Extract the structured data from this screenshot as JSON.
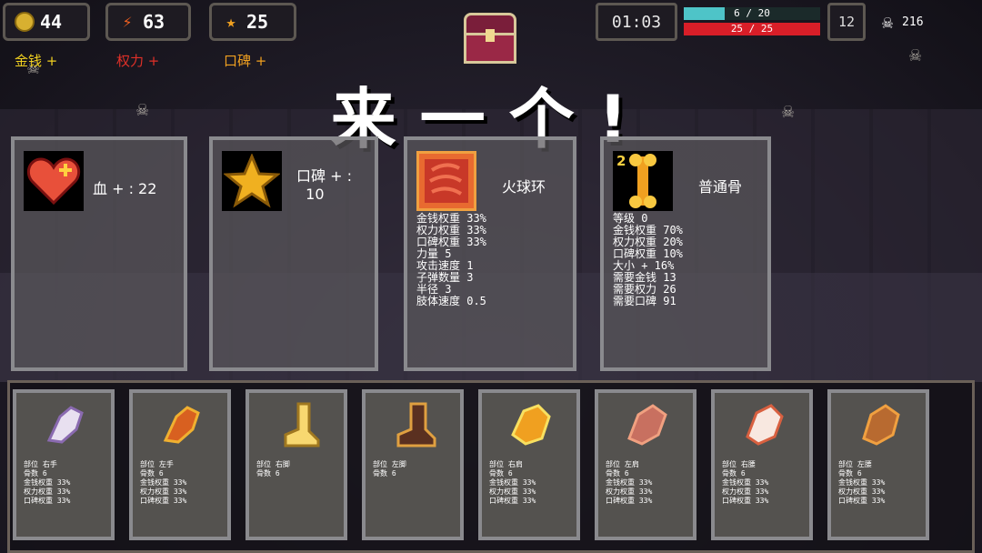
{
  "hud": {
    "gold": "44",
    "power": "63",
    "reputation": "25",
    "gold_plus": "金钱 +",
    "power_plus": "权力 +",
    "reputation_plus": "口碑 +",
    "timer": "01:03",
    "xp_text": "6 / 20",
    "xp_fraction": 0.3,
    "hp_text": "25 / 25",
    "hp_fraction": 1.0,
    "level": "12",
    "kills": "216"
  },
  "title": "来一个!",
  "choices": [
    {
      "name": "血 + : 22",
      "stats": ""
    },
    {
      "name": "口碑 + :\n  10",
      "stats": ""
    },
    {
      "name": "火球环",
      "stats": "金钱权重 33%\n权力权重 33%\n口碑权重 33%\n力量 5\n攻击速度 1\n子弹数量 3\n半径 3\n肢体速度 0.5"
    },
    {
      "name": "普通骨",
      "badge": "2",
      "stats": "等级 0\n金钱权重 70%\n权力权重 20%\n口碑权重 10%\n大小 + 16%\n需要金钱 13\n需要权力 26\n需要口碑 91"
    }
  ],
  "parts": [
    {
      "stats": "部位 右手\n骨数 6\n金钱权重 33%\n权力权重 33%\n口碑权重 33%"
    },
    {
      "stats": "部位 左手\n骨数 6\n金钱权重 33%\n权力权重 33%\n口碑权重 33%"
    },
    {
      "stats": "部位 右脚\n骨数 6"
    },
    {
      "stats": "部位 左脚\n骨数 6"
    },
    {
      "stats": "部位 右肩\n骨数 6\n金钱权重 33%\n权力权重 33%\n口碑权重 33%"
    },
    {
      "stats": "部位 左肩\n骨数 6\n金钱权重 33%\n权力权重 33%\n口碑权重 33%"
    },
    {
      "stats": "部位 右腰\n骨数 6\n金钱权重 33%\n权力权重 33%\n口碑权重 33%"
    },
    {
      "stats": "部位 左腰\n骨数 6\n金钱权重 33%\n权力权重 33%\n口碑权重 33%"
    }
  ],
  "colors": {
    "gold_label": "#f0d020",
    "power_label": "#e03028",
    "rep_label": "#f0a020",
    "xp_fill": "#4ec4c8",
    "hp_fill": "#d81e28"
  },
  "icons": {
    "gold": "coin-icon",
    "power": "lightning-icon",
    "reputation": "star-icon",
    "chest": "treasure-chest-icon",
    "kills": "skull-crossbones-icon"
  }
}
